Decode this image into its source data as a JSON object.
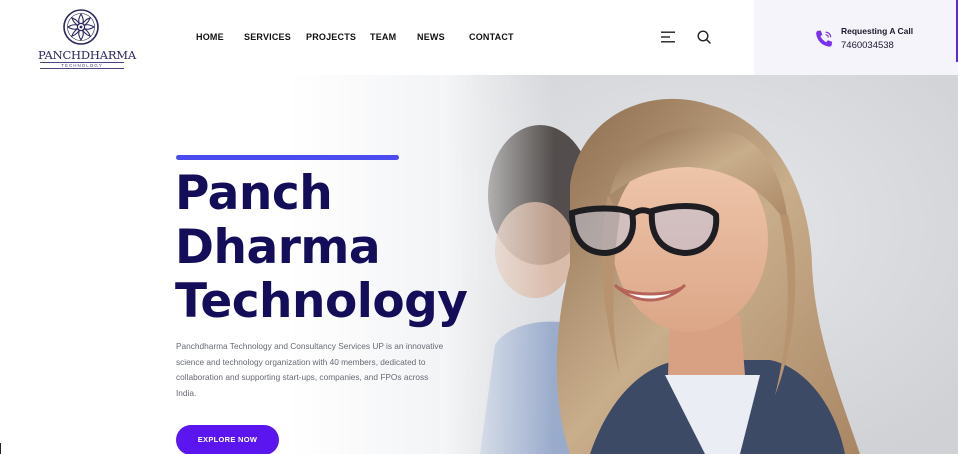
{
  "brand": {
    "name": "PANCHDHARMA",
    "tagline": "TECHNOLOGY"
  },
  "nav": {
    "items": [
      {
        "label": "HOME"
      },
      {
        "label": "SERVICES"
      },
      {
        "label": "PROJECTS"
      },
      {
        "label": "TEAM"
      },
      {
        "label": "NEWS"
      },
      {
        "label": "CONTACT"
      }
    ]
  },
  "header_icons": {
    "menu": "menu-icon",
    "search": "search-icon"
  },
  "call": {
    "label": "Requesting A Call",
    "number": "7460034538",
    "icon": "phone-icon"
  },
  "hero": {
    "title_lines": [
      "Panch",
      "Dharma",
      "Technology"
    ],
    "description": "Panchdharma Technology and Consultancy Services UP is an innovative science and technology organization with 40 members, dedicated to collaboration and supporting start-ups, companies, and FPOs across India.",
    "cta_label": "EXPLORE NOW"
  },
  "colors": {
    "accent": "#4a4cf0",
    "button": "#5b16f0",
    "title": "#130d5a",
    "phone_icon": "#7b2ff2",
    "call_box_bg": "#f5f4fa"
  }
}
